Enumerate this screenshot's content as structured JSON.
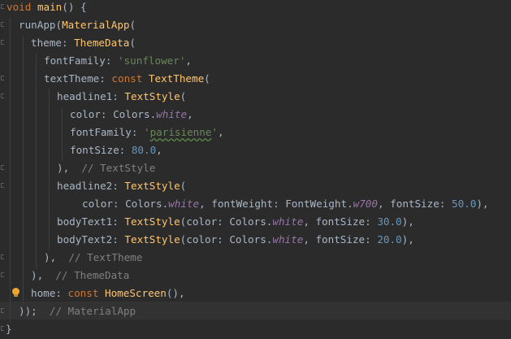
{
  "code": {
    "l1": {
      "k_void": "void",
      "fn_main": "main",
      "p": "() {"
    },
    "l2": {
      "id": "runApp(",
      "cls": "MaterialApp",
      "p": "("
    },
    "l3": {
      "id": "theme: ",
      "cls": "ThemeData",
      "p": "("
    },
    "l4": {
      "id": "fontFamily: ",
      "str": "'sunflower'",
      "p": ","
    },
    "l5": {
      "id": "textTheme: ",
      "kw": "const ",
      "cls": "TextTheme",
      "p": "("
    },
    "l6": {
      "id": "headline1: ",
      "cls": "TextStyle",
      "p": "("
    },
    "l7": {
      "id": "color: Colors.",
      "stat": "white",
      "p": ","
    },
    "l8": {
      "id": "fontFamily: ",
      "str_a": "'",
      "str_b": "parisienne",
      "str_c": "'",
      "p": ","
    },
    "l9": {
      "id": "fontSize: ",
      "num": "80.0",
      "p": ","
    },
    "l10": {
      "p": "),  ",
      "cmt": "// TextStyle"
    },
    "l11": {
      "id": "headline2: ",
      "cls": "TextStyle",
      "p": "("
    },
    "l12": {
      "id_a": "color: Colors.",
      "stat": "white",
      "id_b": ", fontWeight: FontWeight.",
      "stat2": "w700",
      "id_c": ", fontSize: ",
      "num": "50.0",
      "p": "),"
    },
    "l13": {
      "id": "bodyText1: ",
      "cls": "TextStyle",
      "id_a": "(color: Colors.",
      "stat": "white",
      "id_b": ", fontSize: ",
      "num": "30.0",
      "p": "),"
    },
    "l14": {
      "id": "bodyText2: ",
      "cls": "TextStyle",
      "id_a": "(color: Colors.",
      "stat": "white",
      "id_b": ", fontSize: ",
      "num": "20.0",
      "p": "),"
    },
    "l15": {
      "p": "),  ",
      "cmt": "// TextTheme"
    },
    "l16": {
      "p": "),  ",
      "cmt": "// ThemeData"
    },
    "l17": {
      "id": "home: ",
      "kw": "const ",
      "cls": "HomeScreen",
      "p": "(),"
    },
    "l18": {
      "p": "));",
      "sp": "  ",
      "cmt": "// MaterialApp"
    },
    "l19": {
      "p": "}"
    }
  },
  "colors": {
    "background": "#2b2b2b",
    "keyword": "#cc7832",
    "function": "#ffc66d",
    "string": "#6a8759",
    "number": "#6897bb",
    "comment": "#808080",
    "static_field": "#9876aa",
    "identifier": "#a9b7c6"
  },
  "icons": {
    "intention_bulb": "lightbulb-icon"
  }
}
